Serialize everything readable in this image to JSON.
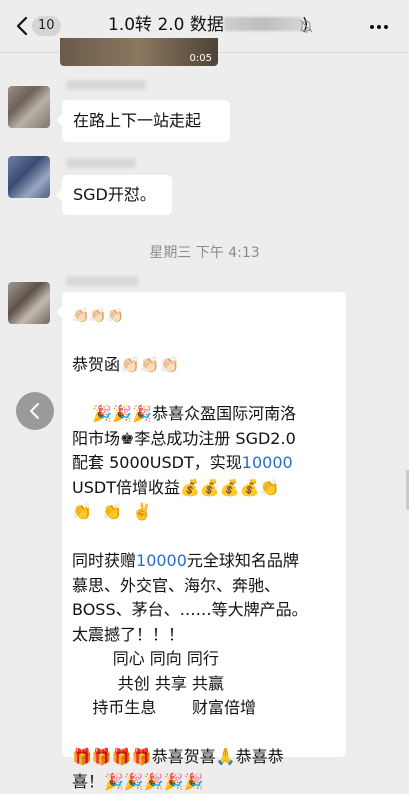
{
  "header": {
    "unread_count": "10",
    "title": "1.0转 2.0 数据",
    "title_suffix": ")"
  },
  "video": {
    "duration": "0:05"
  },
  "messages": [
    {
      "text": "在路上下一站走起"
    },
    {
      "text": "SGD开怼。"
    }
  ],
  "timestamp": "星期三 下午 4:13",
  "long_message": {
    "l1": "👏🏻👏🏻👏🏻",
    "l2": "",
    "l3": "恭贺函👏🏻👏🏻👏🏻",
    "l4": "",
    "l5": "    🎉🎉🎉恭喜众盈国际河南洛",
    "l6": "阳市场♚李总成功注册 SGD2.0",
    "l7_a": "配套 5000USDT，实现",
    "l7_b": "10000",
    "l8": "USDT倍增收益💰💰💰💰👏",
    "l9": "👏  👏  ✌️",
    "l10": "",
    "l11_a": "同时获赠",
    "l11_b": "10000",
    "l11_c": "元全球知名品牌",
    "l12": "慕思、外交官、海尔、奔驰、",
    "l13": "BOSS、茅台、……等大牌产品。",
    "l14": "太震撼了！！！",
    "l15": "        同心 同向 同行",
    "l16": "         共创 共享 共赢",
    "l17": "    持币生息       财富倍增",
    "l18": "",
    "l19": "🎁🎁🎁🎁恭喜贺喜🙏恭喜恭",
    "l20": "喜！🎉🎉🎉🎉🎉"
  }
}
